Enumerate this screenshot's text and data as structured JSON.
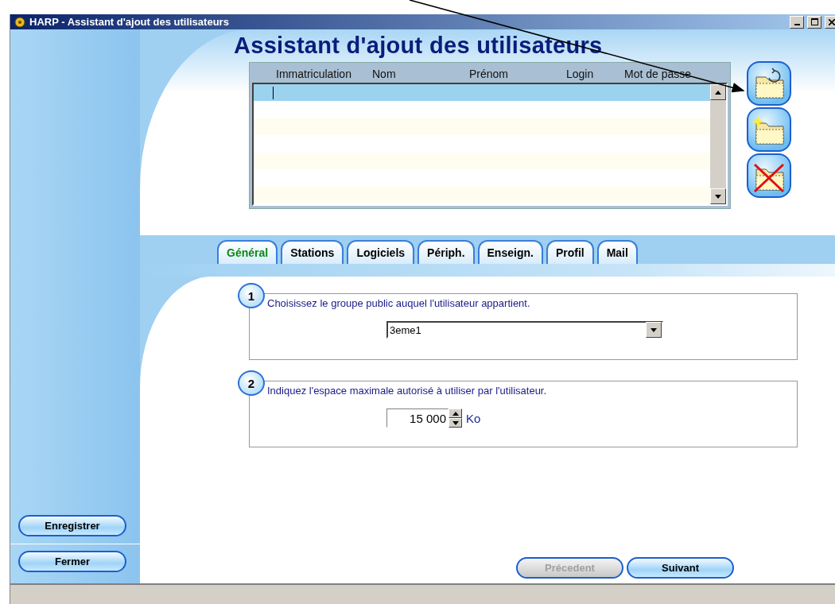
{
  "window": {
    "title": "HARP - Assistant d'ajout des utilisateurs"
  },
  "heading": "Assistant d'ajout des utilisateurs",
  "grid": {
    "columns": [
      "Immatriculation",
      "Nom",
      "Prénom",
      "Login",
      "Mot de passe"
    ],
    "rows": [
      {
        "selected": true
      },
      {
        "selected": false
      },
      {
        "selected": false
      },
      {
        "selected": false
      },
      {
        "selected": false
      },
      {
        "selected": false
      },
      {
        "selected": false
      }
    ]
  },
  "tabs": [
    {
      "label": "Général",
      "selected": true
    },
    {
      "label": "Stations",
      "selected": false
    },
    {
      "label": "Logiciels",
      "selected": false
    },
    {
      "label": "Périph.",
      "selected": false
    },
    {
      "label": "Enseign.",
      "selected": false
    },
    {
      "label": "Profil",
      "selected": false
    },
    {
      "label": "Mail",
      "selected": false
    }
  ],
  "steps": [
    {
      "number": "1",
      "text": "Choisissez le groupe public auquel l'utilisateur appartient.",
      "kind": "dropdown",
      "value": "3eme1"
    },
    {
      "number": "2",
      "text": "Indiquez l'espace maximale autorisé à utiliser par l'utilisateur.",
      "kind": "spinner",
      "value": "15 000",
      "unit": "Ko"
    }
  ],
  "sidebar": {
    "buttons": [
      "Enregistrer",
      "Fermer"
    ]
  },
  "navigation": [
    {
      "label": "Précedent",
      "disabled": true
    },
    {
      "label": "Suivant",
      "disabled": false
    }
  ]
}
